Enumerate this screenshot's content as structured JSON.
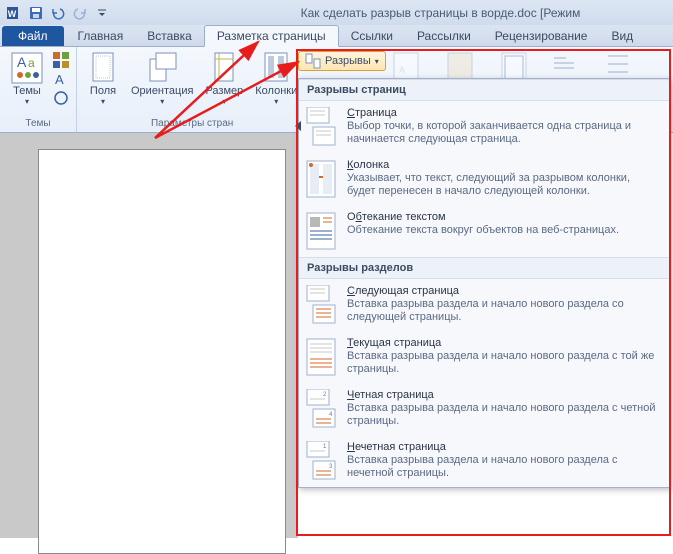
{
  "titlebar": {
    "document_title": "Как сделать разрыв страницы в ворде.doc [Режим"
  },
  "tabs": {
    "file": "Файл",
    "items": [
      "Главная",
      "Вставка",
      "Разметка страницы",
      "Ссылки",
      "Рассылки",
      "Рецензирование",
      "Вид"
    ],
    "active_index": 2
  },
  "ribbon": {
    "themes_group": {
      "btn": "Темы",
      "label": "Темы"
    },
    "page_setup": {
      "margins": "Поля",
      "orientation": "Ориентация",
      "size": "Размер",
      "columns": "Колонки",
      "label": "Параметры стран"
    },
    "breaks_button": "Разрывы"
  },
  "dropdown": {
    "section1_header": "Разрывы страниц",
    "section2_header": "Разрывы разделов",
    "page_breaks": [
      {
        "title_pre": "",
        "key": "С",
        "title_post": "траница",
        "desc": "Выбор точки, в которой заканчивается одна страница и начинается следующая страница."
      },
      {
        "title_pre": "",
        "key": "К",
        "title_post": "олонка",
        "desc": "Указывает, что текст, следующий за разрывом колонки, будет перенесен в начало следующей колонки."
      },
      {
        "title_pre": "О",
        "key": "б",
        "title_post": "текание текстом",
        "desc": "Обтекание текста вокруг объектов на веб-страницах."
      }
    ],
    "section_breaks": [
      {
        "title_pre": "",
        "key": "С",
        "title_post": "ледующая страница",
        "desc": "Вставка разрыва раздела и начало нового раздела со следующей страницы."
      },
      {
        "title_pre": "",
        "key": "Т",
        "title_post": "екущая страница",
        "desc": "Вставка разрыва раздела и начало нового раздела с той же страницы."
      },
      {
        "title_pre": "",
        "key": "Ч",
        "title_post": "етная страница",
        "desc": "Вставка разрыва раздела и начало нового раздела с четной страницы."
      },
      {
        "title_pre": "",
        "key": "Н",
        "title_post": "ечетная страница",
        "desc": "Вставка разрыва раздела и начало нового раздела с нечетной страницы."
      }
    ]
  }
}
